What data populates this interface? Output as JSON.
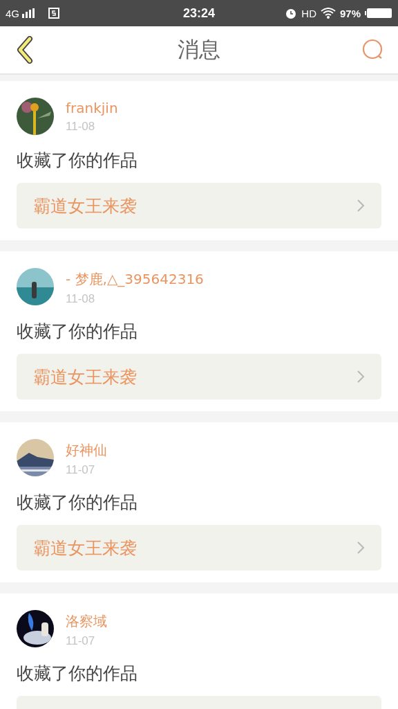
{
  "status_bar": {
    "network": "4G",
    "time": "23:24",
    "hd": "HD",
    "battery": "97%"
  },
  "header": {
    "title": "消息"
  },
  "messages": [
    {
      "user": "frankjin",
      "date": "11-08",
      "action": "收藏了你的作品",
      "work": "霸道女王来袭"
    },
    {
      "user": "- 梦鹿,△_395642316",
      "date": "11-08",
      "action": "收藏了你的作品",
      "work": "霸道女王来袭"
    },
    {
      "user": "好神仙",
      "date": "11-07",
      "action": "收藏了你的作品",
      "work": "霸道女王来袭"
    },
    {
      "user": "洛察域",
      "date": "11-07",
      "action": "收藏了你的作品"
    }
  ]
}
